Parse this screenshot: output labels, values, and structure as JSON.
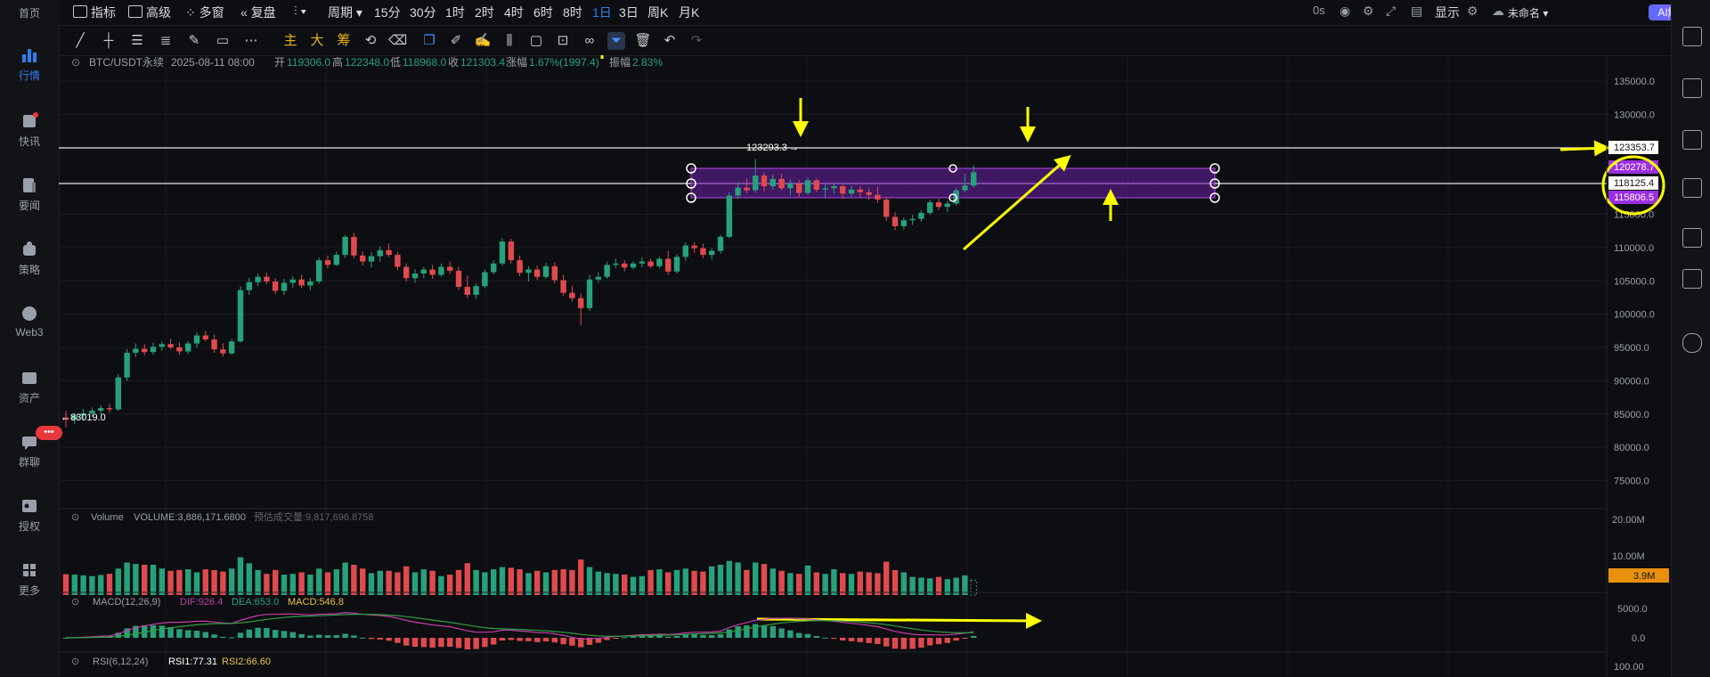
{
  "left_nav": [
    {
      "label": "首页",
      "icon": "home-icon"
    },
    {
      "label": "行情",
      "icon": "market-chart-icon",
      "active": true
    },
    {
      "label": "快讯",
      "icon": "flash-news-icon"
    },
    {
      "label": "要闻",
      "icon": "news-icon"
    },
    {
      "label": "策略",
      "icon": "strategy-icon"
    },
    {
      "label": "Web3",
      "icon": "web3-icon"
    },
    {
      "label": "资产",
      "icon": "wallet-icon"
    },
    {
      "label": "群聊",
      "icon": "chat-icon"
    },
    {
      "label": "授权",
      "icon": "authorize-icon"
    },
    {
      "label": "更多",
      "icon": "more-grid-icon"
    }
  ],
  "chat_badge": "•••",
  "toolbar": {
    "indicators": "指标",
    "advanced": "高级",
    "multi_window": "多窗",
    "replay": "复盘",
    "period": "周期",
    "intervals": [
      "15分",
      "30分",
      "1时",
      "2时",
      "4时",
      "6时",
      "8时",
      "1日",
      "3日",
      "周K",
      "月K"
    ],
    "selected_interval": "1日",
    "latency": "0s",
    "display": "显示",
    "unnamed": "未命名",
    "ai_button": "AI解读"
  },
  "drawing_tools": {
    "main": "主",
    "big": "大",
    "chip": "筹"
  },
  "chart_header": {
    "symbol": "BTC/USDT永续",
    "datetime": "2025-08-11 08:00",
    "open_label": "开",
    "open": "119306.0",
    "high_label": "高",
    "high": "122348.0",
    "low_label": "低",
    "low": "118968.0",
    "close_label": "收",
    "close": "121303.4",
    "change_label": "涨幅",
    "change": "1.67%(1997.4)",
    "amplitude_label": "振幅",
    "amplitude": "2.83%"
  },
  "price_axis": [
    "135000.0",
    "130000.0",
    "125000.0",
    "120000.0",
    "115000.0",
    "110000.0",
    "105000.0",
    "100000.0",
    "95000.0",
    "90000.0",
    "85000.0",
    "80000.0",
    "75000.0"
  ],
  "price_tags": {
    "h_line_upper": "123353.7",
    "zone_top": "120278.7",
    "zone_mid": "118125.4",
    "zone_bottom": "115806.5"
  },
  "chart_labels": {
    "max_price": "123293.3",
    "min_price": "83019.0"
  },
  "volume_pane": {
    "title": "Volume",
    "volume_value": "VOLUME:3,886,171.6800",
    "estimate": "预估成交量:9,817,696.8758",
    "axis": [
      "20.00M",
      "10.00M"
    ],
    "current_tag": "3.9M"
  },
  "macd_pane": {
    "title": "MACD(12,26,9)",
    "dif": "DIF:926.4",
    "dea": "DEA:653.0",
    "macd": "MACD:546.8",
    "axis": [
      "5000.0",
      "0.0"
    ]
  },
  "rsi_pane": {
    "title": "RSI(6,12,24)",
    "rsi1": "RSI1:77.31",
    "rsi2": "RSI2:66.60",
    "axis": [
      "100.00"
    ]
  },
  "colors": {
    "up": "#26a17b",
    "down": "#e04a4e",
    "accent": "#2f7ff0",
    "zone": "#7b2cbf",
    "annotation": "#ffff00",
    "volume_tag": "#e8900c"
  },
  "chart_data": {
    "type": "candlestick",
    "x_labels": [],
    "ohlc": [
      [
        84500,
        85500,
        83019,
        84200
      ],
      [
        84200,
        85200,
        83500,
        84800
      ],
      [
        84800,
        85800,
        84100,
        85100
      ],
      [
        85100,
        86000,
        84600,
        85500
      ],
      [
        85500,
        86300,
        84900,
        85900
      ],
      [
        85900,
        86600,
        85200,
        85700
      ],
      [
        85700,
        91000,
        85500,
        90500
      ],
      [
        90500,
        94800,
        90000,
        94200
      ],
      [
        94200,
        95600,
        93600,
        94800
      ],
      [
        94800,
        95500,
        93800,
        94300
      ],
      [
        94300,
        95700,
        93900,
        95100
      ],
      [
        95100,
        95900,
        94500,
        95500
      ],
      [
        95500,
        96300,
        94700,
        95000
      ],
      [
        95000,
        95800,
        93900,
        94400
      ],
      [
        94400,
        96000,
        94000,
        95600
      ],
      [
        95600,
        97300,
        95000,
        96800
      ],
      [
        96800,
        97500,
        95900,
        96200
      ],
      [
        96200,
        96900,
        94200,
        94700
      ],
      [
        94700,
        95600,
        93600,
        94100
      ],
      [
        94100,
        96300,
        93900,
        95900
      ],
      [
        95900,
        104200,
        95700,
        103600
      ],
      [
        103600,
        105500,
        102900,
        104800
      ],
      [
        104800,
        106100,
        104200,
        105600
      ],
      [
        105600,
        106200,
        104500,
        104900
      ],
      [
        104900,
        105400,
        103000,
        103500
      ],
      [
        103500,
        105300,
        102900,
        104700
      ],
      [
        104700,
        105700,
        104000,
        105200
      ],
      [
        105200,
        105900,
        103900,
        104300
      ],
      [
        104300,
        105400,
        103600,
        104900
      ],
      [
        104900,
        108500,
        104600,
        108100
      ],
      [
        108100,
        108800,
        106900,
        107400
      ],
      [
        107400,
        109400,
        107200,
        108900
      ],
      [
        108900,
        111900,
        108400,
        111600
      ],
      [
        111600,
        112200,
        108400,
        108800
      ],
      [
        108800,
        109400,
        107300,
        107900
      ],
      [
        107900,
        109300,
        107000,
        108700
      ],
      [
        108700,
        110200,
        107900,
        109600
      ],
      [
        109600,
        110600,
        108600,
        108900
      ],
      [
        108900,
        109300,
        106600,
        107100
      ],
      [
        107100,
        107600,
        104900,
        105400
      ],
      [
        105400,
        106700,
        104700,
        106100
      ],
      [
        106100,
        107100,
        105400,
        106700
      ],
      [
        106700,
        107400,
        105300,
        105900
      ],
      [
        105900,
        107600,
        105600,
        107100
      ],
      [
        107100,
        107900,
        106000,
        106500
      ],
      [
        106500,
        107100,
        103600,
        104100
      ],
      [
        104100,
        105800,
        102400,
        102900
      ],
      [
        102900,
        104600,
        102300,
        104200
      ],
      [
        104200,
        106700,
        103900,
        106300
      ],
      [
        106300,
        108100,
        106000,
        107600
      ],
      [
        107600,
        111400,
        107300,
        110900
      ],
      [
        110900,
        111300,
        107600,
        108100
      ],
      [
        108100,
        108800,
        105700,
        106200
      ],
      [
        106200,
        107200,
        104900,
        106700
      ],
      [
        106700,
        107300,
        105100,
        105600
      ],
      [
        105600,
        107700,
        105300,
        107200
      ],
      [
        107200,
        107800,
        104600,
        105100
      ],
      [
        105100,
        105900,
        102700,
        103200
      ],
      [
        103200,
        104300,
        101900,
        102400
      ],
      [
        102400,
        103100,
        98300,
        100900
      ],
      [
        100900,
        105900,
        100500,
        105200
      ],
      [
        105200,
        106300,
        104700,
        105600
      ],
      [
        105600,
        107900,
        105300,
        107400
      ],
      [
        107400,
        108300,
        106900,
        107600
      ],
      [
        107600,
        108100,
        106400,
        107000
      ],
      [
        107000,
        107900,
        106700,
        107600
      ],
      [
        107600,
        108500,
        107000,
        107900
      ],
      [
        107900,
        108300,
        106900,
        107200
      ],
      [
        107200,
        108600,
        106900,
        108300
      ],
      [
        108300,
        109500,
        105900,
        106400
      ],
      [
        106400,
        109000,
        106100,
        108600
      ],
      [
        108600,
        110800,
        108000,
        110300
      ],
      [
        110300,
        110800,
        109200,
        109900
      ],
      [
        109900,
        110600,
        108400,
        108900
      ],
      [
        108900,
        109900,
        108200,
        109500
      ],
      [
        109500,
        111900,
        109100,
        111600
      ],
      [
        111600,
        118300,
        111400,
        117800
      ],
      [
        117800,
        119800,
        117300,
        119000
      ],
      [
        119000,
        120400,
        118100,
        118600
      ],
      [
        118600,
        123293,
        118200,
        120800
      ],
      [
        120800,
        121300,
        118400,
        119200
      ],
      [
        119200,
        120900,
        118700,
        120300
      ],
      [
        120300,
        121100,
        118600,
        118900
      ],
      [
        118900,
        120200,
        117900,
        119600
      ],
      [
        119600,
        120100,
        117600,
        118200
      ],
      [
        118200,
        120500,
        117900,
        120100
      ],
      [
        120100,
        120400,
        118300,
        118700
      ],
      [
        118700,
        119500,
        117500,
        118900
      ],
      [
        118900,
        119700,
        118100,
        119200
      ],
      [
        119200,
        119600,
        117300,
        118100
      ],
      [
        118100,
        119300,
        117600,
        118700
      ],
      [
        118700,
        119200,
        117500,
        118300
      ],
      [
        118300,
        118900,
        117200,
        117900
      ],
      [
        117900,
        119100,
        116700,
        117200
      ],
      [
        117200,
        117600,
        114000,
        114600
      ],
      [
        114600,
        115300,
        112600,
        113200
      ],
      [
        113200,
        114500,
        112700,
        114100
      ],
      [
        114100,
        114900,
        113400,
        114300
      ],
      [
        114300,
        115600,
        113900,
        115200
      ],
      [
        115200,
        117200,
        114900,
        116800
      ],
      [
        116800,
        117300,
        115600,
        116100
      ],
      [
        116100,
        117000,
        115300,
        116600
      ],
      [
        116600,
        119000,
        116300,
        118600
      ],
      [
        118600,
        121100,
        118300,
        119300
      ],
      [
        119300,
        122348,
        118968,
        121303
      ]
    ],
    "volume_m": [
      5.5,
      5.4,
      5.2,
      5.0,
      5.3,
      5.6,
      7.0,
      8.6,
      8.2,
      8.0,
      8.0,
      7.0,
      6.4,
      6.6,
      6.8,
      6.0,
      6.8,
      6.6,
      6.2,
      7.0,
      10.0,
      8.4,
      6.6,
      5.6,
      6.6,
      5.4,
      5.6,
      6.0,
      5.4,
      7.0,
      6.0,
      6.8,
      8.6,
      8.0,
      7.0,
      5.8,
      6.4,
      6.4,
      6.0,
      7.6,
      6.0,
      6.8,
      6.4,
      5.0,
      5.4,
      6.6,
      8.4,
      6.6,
      6.0,
      6.8,
      7.4,
      7.2,
      6.8,
      5.8,
      6.4,
      6.0,
      6.6,
      6.8,
      6.6,
      9.4,
      7.4,
      6.2,
      5.8,
      5.6,
      5.4,
      4.8,
      5.0,
      6.6,
      6.8,
      6.0,
      6.6,
      7.0,
      6.4,
      6.2,
      7.6,
      8.0,
      9.0,
      8.6,
      6.6,
      8.6,
      8.2,
      7.0,
      6.4,
      5.8,
      5.6,
      7.8,
      6.0,
      5.6,
      6.8,
      5.8,
      5.6,
      6.2,
      6.0,
      5.8,
      8.8,
      6.6,
      6.0,
      4.8,
      4.6,
      4.4,
      4.8,
      4.2,
      4.6,
      5.2,
      3.9
    ],
    "dif": [],
    "dea": [],
    "macd": [],
    "ylim": [
      72000,
      137000
    ]
  }
}
